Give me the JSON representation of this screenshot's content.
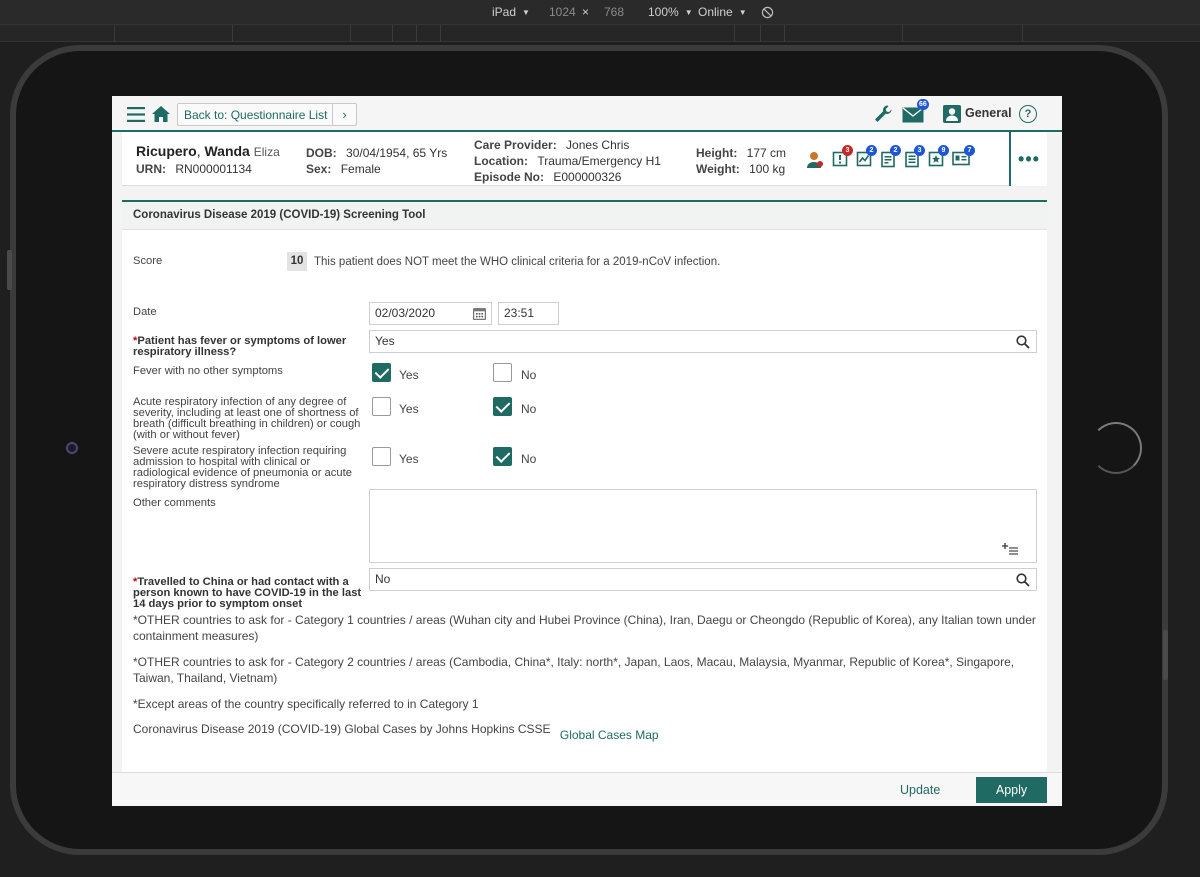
{
  "devtools": {
    "device": "iPad",
    "width": "1024",
    "times": "×",
    "height": "768",
    "zoom": "100%",
    "network": "Online"
  },
  "topbar": {
    "back_label": "Back to: Questionnaire List",
    "forward_glyph": "›",
    "mail_count": "66",
    "user_label": "General",
    "help_glyph": "?"
  },
  "patient": {
    "surname": "Ricupero",
    "given": "Wanda",
    "middle": "Eliza",
    "urn_label": "URN:",
    "urn": "RN000001134",
    "dob_label": "DOB:",
    "dob": "30/04/1954, 65 Yrs",
    "sex_label": "Sex:",
    "sex": "Female",
    "provider_label": "Care Provider:",
    "provider": "Jones Chris",
    "location_label": "Location:",
    "location": "Trauma/Emergency H1",
    "episode_label": "Episode No:",
    "episode": "E000000326",
    "height_label": "Height:",
    "height": "177 cm",
    "weight_label": "Weight:",
    "weight": "100 kg",
    "more_glyph": "•••"
  },
  "banner_icons": [
    {
      "name": "care-team-icon",
      "badge": ""
    },
    {
      "name": "alerts-icon",
      "badge": "3",
      "color": "#c62828"
    },
    {
      "name": "observations-chart-icon",
      "badge": "2",
      "color": "#1e56d6"
    },
    {
      "name": "notes-icon",
      "badge": "2",
      "color": "#1e56d6"
    },
    {
      "name": "orders-list-icon",
      "badge": "3",
      "color": "#1e56d6"
    },
    {
      "name": "favourites-icon",
      "badge": "9",
      "color": "#1e56d6"
    },
    {
      "name": "id-card-icon",
      "badge": "7",
      "color": "#1e56d6"
    }
  ],
  "form": {
    "title": "Coronavirus Disease 2019 (COVID-19) Screening Tool",
    "score_label": "Score",
    "score_value": "10",
    "score_text": "This patient does NOT meet the WHO clinical criteria for a 2019-nCoV infection.",
    "date_label": "Date",
    "date_value": "02/03/2020",
    "time_value": "23:51",
    "q_fever_label": "Patient has fever or symptoms of lower respiratory illness?",
    "q_fever_value": "Yes",
    "q1_label": "Fever with no other symptoms",
    "q2_label": "Acute respiratory infection of any degree of severity, including at least one of shortness of breath (difficult breathing in children) or cough (with or without fever)",
    "q3_label": "Severe acute respiratory infection requiring admission to hospital with clinical or radiological evidence of pneumonia or acute respiratory distress syndrome",
    "yes_label": "Yes",
    "no_label": "No",
    "q1_yes": true,
    "q1_no": false,
    "q2_yes": false,
    "q2_no": true,
    "q3_yes": false,
    "q3_no": true,
    "comments_label": "Other comments",
    "comments_value": "",
    "q_travel_label": "Travelled to China or had contact with a person known to have COVID-19 in the last 14 days prior to symptom onset",
    "q_travel_value": "No",
    "note1": "*OTHER countries to ask for - Category 1 countries / areas (Wuhan city and Hubei Province (China), Iran, Daegu or Cheongdo (Republic of Korea), any Italian town under containment measures)",
    "note2": "*OTHER countries to ask for - Category 2 countries / areas (Cambodia, China*, Italy: north*, Japan, Laos, Macau, Malaysia, Myanmar, Republic of Korea*, Singapore, Taiwan, Thailand, Vietnam)",
    "note3": "*Except areas of the country specifically referred to in Category 1",
    "cases_text": "Coronavirus Disease 2019 (COVID-19) Global Cases by Johns Hopkins CSSE",
    "cases_link": "Global Cases Map"
  },
  "footer": {
    "update_label": "Update",
    "apply_label": "Apply"
  },
  "colors": {
    "accent": "#1f6b63",
    "alert_badge": "#c62828",
    "info_badge": "#1e56d6"
  }
}
